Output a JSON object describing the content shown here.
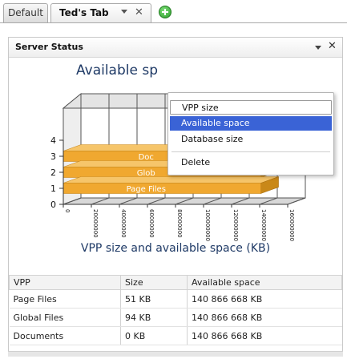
{
  "tabs": [
    {
      "label": "Default"
    },
    {
      "label": "Ted's Tab",
      "close": "✕"
    }
  ],
  "gadget": {
    "title": "Server Status",
    "close": "✕",
    "chart_title": "Available sp",
    "chart_subtitle": "VPP size and available space (KB)"
  },
  "menu": {
    "items": [
      "VPP size",
      "Available space",
      "Database size",
      "Delete"
    ],
    "selected": "Available space"
  },
  "chart_data": {
    "type": "bar",
    "orientation": "horizontal",
    "style": "3d",
    "categories": [
      "Page Files",
      "Global Files",
      "Documents"
    ],
    "bar_labels": [
      "Page Files",
      "Glob",
      "Doc"
    ],
    "series": [
      {
        "values": [
          140866668,
          140866668,
          140866668
        ]
      }
    ],
    "y_ticks": [
      "0",
      "1",
      "2",
      "3",
      "4"
    ],
    "x_ticks": [
      "0",
      "20000000",
      "40000000",
      "60000000",
      "80000000",
      "100000000",
      "120000000",
      "140000000",
      "160000000"
    ],
    "xlim": [
      0,
      160000000
    ],
    "bar_color": "#f0a830",
    "grid": true
  },
  "table": {
    "headers": [
      "VPP",
      "Size",
      "Available space"
    ],
    "rows": [
      [
        "Page Files",
        "51 KB",
        "140 866 668 KB"
      ],
      [
        "Global Files",
        "94 KB",
        "140 866 668 KB"
      ],
      [
        "Documents",
        "0 KB",
        "140 866 668 KB"
      ]
    ]
  }
}
